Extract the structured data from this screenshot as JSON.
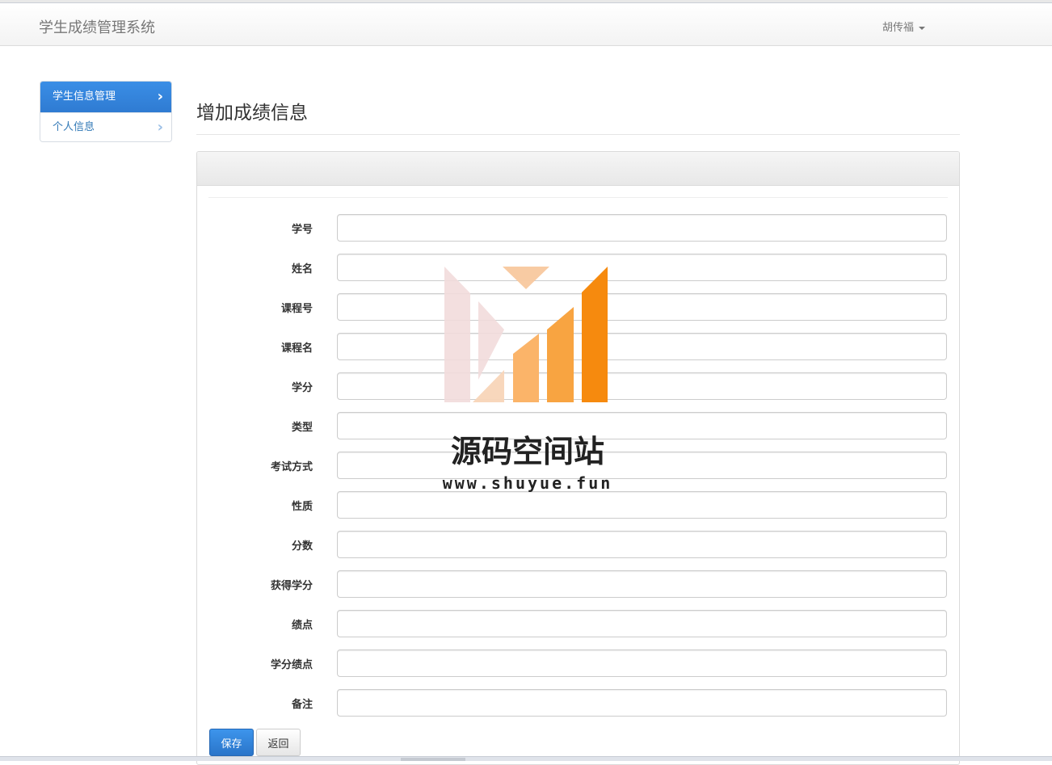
{
  "navbar": {
    "brand": "学生成绩管理系统",
    "user": "胡传福"
  },
  "sidebar": {
    "items": [
      {
        "label": "学生信息管理",
        "active": true
      },
      {
        "label": "个人信息",
        "active": false
      }
    ]
  },
  "page": {
    "title": "增加成绩信息"
  },
  "form": {
    "fields": [
      {
        "label": "学号",
        "value": ""
      },
      {
        "label": "姓名",
        "value": ""
      },
      {
        "label": "课程号",
        "value": ""
      },
      {
        "label": "课程名",
        "value": ""
      },
      {
        "label": "学分",
        "value": ""
      },
      {
        "label": "类型",
        "value": ""
      },
      {
        "label": "考试方式",
        "value": ""
      },
      {
        "label": "性质",
        "value": ""
      },
      {
        "label": "分数",
        "value": ""
      },
      {
        "label": "获得学分",
        "value": ""
      },
      {
        "label": "绩点",
        "value": ""
      },
      {
        "label": "学分绩点",
        "value": ""
      },
      {
        "label": "备注",
        "value": ""
      }
    ],
    "save_label": "保存",
    "back_label": "返回"
  },
  "watermark": {
    "name": "源码空间站",
    "url": "www.shuyue.fun"
  },
  "colors": {
    "primary": "#337ab7",
    "accent_orange": "#f68a0e"
  }
}
